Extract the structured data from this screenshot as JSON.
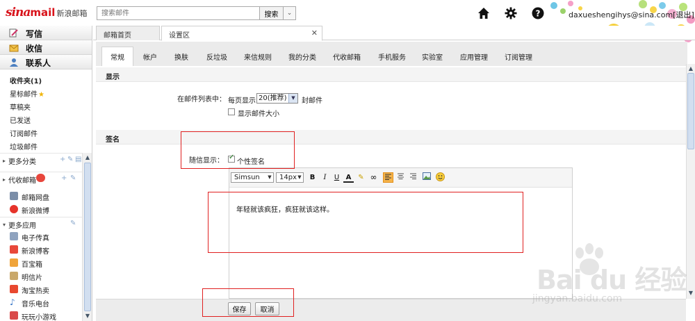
{
  "header": {
    "logo_sina": "sina",
    "logo_mail": "mail",
    "logo_cn": "新浪邮箱",
    "search_placeholder": "搜索邮件",
    "search_button": "搜索",
    "user_email": "daxueshengihys@sina.com",
    "logout": "[退出]",
    "icons": [
      "home-icon",
      "gear-icon",
      "help-icon"
    ]
  },
  "sidebar": {
    "compose": "写信",
    "inbox_btn": "收信",
    "contacts": "联系人",
    "folders": [
      "收件夹(1)",
      "星标邮件",
      "草稿夹",
      "已发送",
      "订阅邮件",
      "垃圾邮件"
    ],
    "more_folders": "更多分类",
    "proxy_mail": "代收邮箱",
    "proxy_items": [
      "邮箱网盘",
      "新浪微博"
    ],
    "more_apps": "更多应用",
    "apps": [
      "电子传真",
      "新浪博客",
      "百宝箱",
      "明信片",
      "淘宝热卖",
      "音乐电台",
      "玩玩小游戏"
    ]
  },
  "doc_tabs": {
    "home": "邮箱首页",
    "settings": "设置区"
  },
  "settings_tabs": [
    "常规",
    "帐户",
    "换肤",
    "反垃圾",
    "来信规则",
    "我的分类",
    "代收邮箱",
    "手机服务",
    "实验室",
    "应用管理",
    "订阅管理"
  ],
  "display": {
    "heading": "显示",
    "list_label": "在邮件列表中：",
    "per_page_prefix": "每页显示",
    "per_page_value": "20(推荐)",
    "per_page_suffix": "封邮件",
    "show_size_label": "显示邮件大小"
  },
  "signature": {
    "heading": "签名",
    "with_letter_label": "随信显示：",
    "personal_sig_label": "个性签名",
    "font_family": "Simsun",
    "font_size": "14px",
    "text": "年轻就该疯狂，疯狂就该这样。"
  },
  "actions": {
    "save": "保存",
    "cancel": "取消"
  },
  "watermark": {
    "brand": "Bai du 经验",
    "url": "jingyan.baidu.com"
  },
  "colors": {
    "brand_red": "#d8131b",
    "accent_orange": "#f6b44b",
    "annotation_red": "#e02020"
  }
}
